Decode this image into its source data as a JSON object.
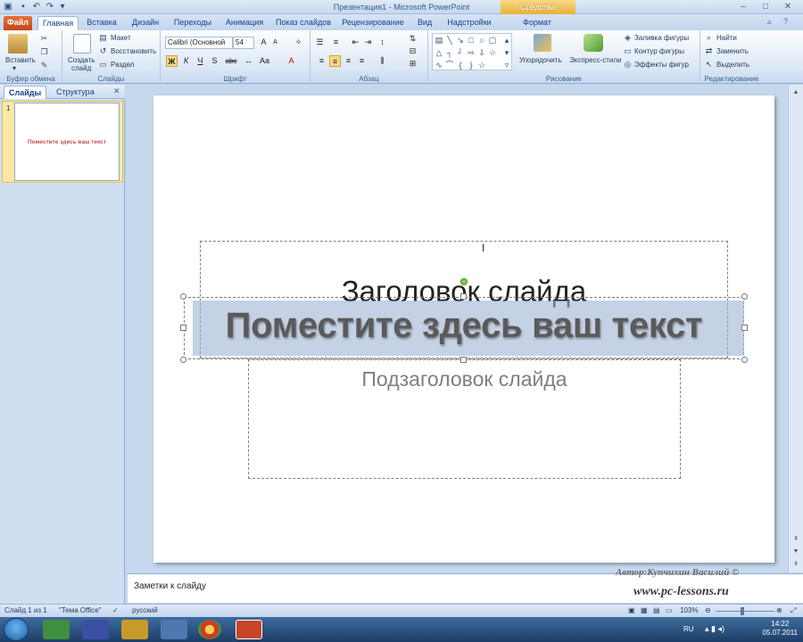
{
  "window": {
    "title": "Презентация1 - Microsoft PowerPoint",
    "context_tab": "Средства рисования"
  },
  "tabs": [
    {
      "label": "Файл"
    },
    {
      "label": "Главная"
    },
    {
      "label": "Вставка"
    },
    {
      "label": "Дизайн"
    },
    {
      "label": "Переходы"
    },
    {
      "label": "Анимация"
    },
    {
      "label": "Показ слайдов"
    },
    {
      "label": "Рецензирование"
    },
    {
      "label": "Вид"
    },
    {
      "label": "Надстройки"
    },
    {
      "label": "Формат"
    }
  ],
  "ribbon": {
    "clipboard": {
      "paste": "Вставить",
      "group": "Буфер обмена"
    },
    "slides": {
      "new_slide_1": "Создать",
      "new_slide_2": "слайд",
      "layout": "Макет",
      "reset": "Восстановить",
      "section": "Раздел",
      "group": "Слайды"
    },
    "font": {
      "name": "Calibri (Основной",
      "size": "54",
      "group": "Шрифт",
      "bold": "Ж",
      "italic": "К",
      "underline": "Ч",
      "shadow": "S",
      "strike": "abc"
    },
    "paragraph": {
      "group": "Абзац"
    },
    "drawing": {
      "arrange": "Упорядочить",
      "quick_styles": "Экспресс-стили",
      "fill": "Заливка фигуры",
      "outline": "Контур фигуры",
      "effects": "Эффекты фигур",
      "group": "Рисование"
    },
    "editing": {
      "find": "Найти",
      "replace": "Заменить",
      "select": "Выделить",
      "group": "Редактирование"
    }
  },
  "left_panel": {
    "tab_slides": "Слайды",
    "tab_outline": "Структура",
    "slide_number": "1",
    "thumbnail_text": "Поместите здесь ваш текст"
  },
  "slide": {
    "title": "Заголовок слайда",
    "subtitle": "Подзаголовок слайда",
    "wordart": "Поместите здесь ваш текст"
  },
  "notes": {
    "placeholder": "Заметки к слайду"
  },
  "watermark": {
    "author": "Автор:Купчихин Василий ©",
    "site": "www.pc-lessons.ru"
  },
  "status": {
    "slide": "Слайд 1 из 1",
    "theme": "\"Тема Office\"",
    "language": "русский",
    "zoom": "103%"
  },
  "taskbar": {
    "lang": "RU",
    "time": "14:22",
    "date": "05.07.2011"
  },
  "colors": {
    "accent": "#c0504d",
    "file_tab": "#d35a26",
    "selection": "#fcd983",
    "context_tab": "#f0c050"
  }
}
